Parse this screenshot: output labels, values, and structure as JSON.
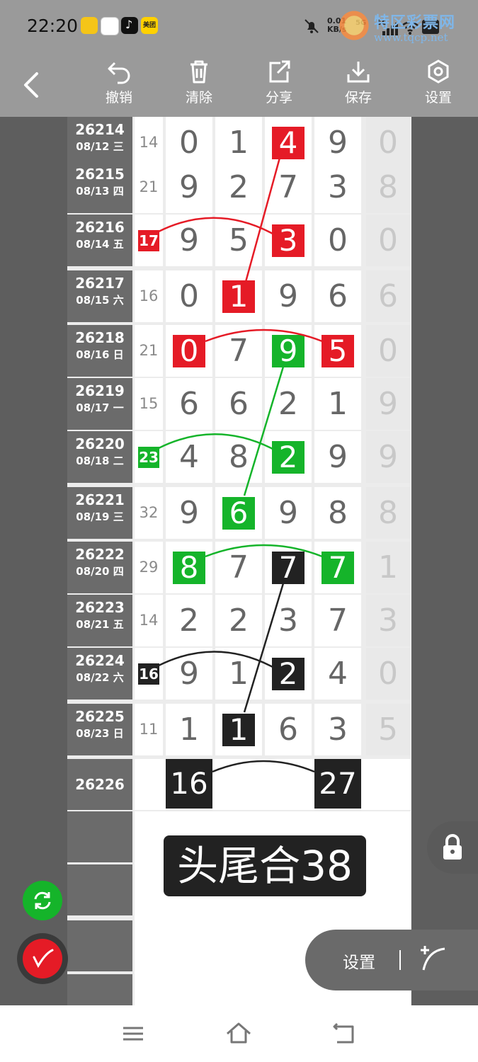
{
  "status_bar": {
    "time": "22:20",
    "app_icons": [
      "app-yellow-icon",
      "app-avatar-icon",
      "tiktok-icon",
      "meituan-icon"
    ],
    "app_labels": {
      "meituan": "美团"
    },
    "net_speed": "0.01\nKB/s",
    "signal_labels": [
      "5G",
      "5G"
    ],
    "battery_level": "",
    "watermark_title": "特区彩票网",
    "watermark_url": "www.tqcp.net"
  },
  "toolbar": {
    "back_icon": "chevron-left-icon",
    "items": [
      {
        "label": "撤销",
        "icon": "undo-icon"
      },
      {
        "label": "清除",
        "icon": "trash-icon"
      },
      {
        "label": "分享",
        "icon": "share-icon"
      },
      {
        "label": "保存",
        "icon": "download-icon"
      },
      {
        "label": "设置",
        "icon": "hexagon-settings-icon"
      }
    ]
  },
  "rows": [
    {
      "period": "26214",
      "date": "08/12 三",
      "sum": "14",
      "digits": [
        "0",
        "1",
        "4",
        "9"
      ],
      "extra": "0"
    },
    {
      "period": "26215",
      "date": "08/13 四",
      "sum": "21",
      "digits": [
        "9",
        "2",
        "7",
        "3"
      ],
      "extra": "8"
    },
    {
      "period": "26216",
      "date": "08/14 五",
      "sum": "17",
      "digits": [
        "9",
        "5",
        "3",
        "0"
      ],
      "extra": "0"
    },
    {
      "period": "26217",
      "date": "08/15 六",
      "sum": "16",
      "digits": [
        "0",
        "1",
        "9",
        "6"
      ],
      "extra": "6"
    },
    {
      "period": "26218",
      "date": "08/16 日",
      "sum": "21",
      "digits": [
        "0",
        "7",
        "9",
        "5"
      ],
      "extra": "0"
    },
    {
      "period": "26219",
      "date": "08/17 一",
      "sum": "15",
      "digits": [
        "6",
        "6",
        "2",
        "1"
      ],
      "extra": "9"
    },
    {
      "period": "26220",
      "date": "08/18 二",
      "sum": "23",
      "digits": [
        "4",
        "8",
        "2",
        "9"
      ],
      "extra": "9"
    },
    {
      "period": "26221",
      "date": "08/19 三",
      "sum": "32",
      "digits": [
        "9",
        "6",
        "9",
        "8"
      ],
      "extra": "8"
    },
    {
      "period": "26222",
      "date": "08/20 四",
      "sum": "29",
      "digits": [
        "8",
        "7",
        "7",
        "7"
      ],
      "extra": "1"
    },
    {
      "period": "26223",
      "date": "08/21 五",
      "sum": "14",
      "digits": [
        "2",
        "2",
        "3",
        "7"
      ],
      "extra": "3"
    },
    {
      "period": "26224",
      "date": "08/22 六",
      "sum": "16",
      "digits": [
        "9",
        "1",
        "2",
        "4"
      ],
      "extra": "0"
    },
    {
      "period": "26225",
      "date": "08/23 日",
      "sum": "11",
      "digits": [
        "1",
        "1",
        "6",
        "3"
      ],
      "extra": "5"
    }
  ],
  "next_period": {
    "period": "26226",
    "head": "16",
    "tail": "27"
  },
  "banner": "头尾合38",
  "floating": {
    "settings_label": "设置",
    "lock_icon": "lock-icon",
    "refresh_icon": "refresh-icon",
    "pen_icon": "pen-icon",
    "draw_line_icon": "draw-curve-icon"
  },
  "colors": {
    "red": "#e51b26",
    "green": "#15b42a",
    "black": "#222222"
  },
  "nav": [
    "menu-icon",
    "home-icon",
    "back-icon"
  ]
}
